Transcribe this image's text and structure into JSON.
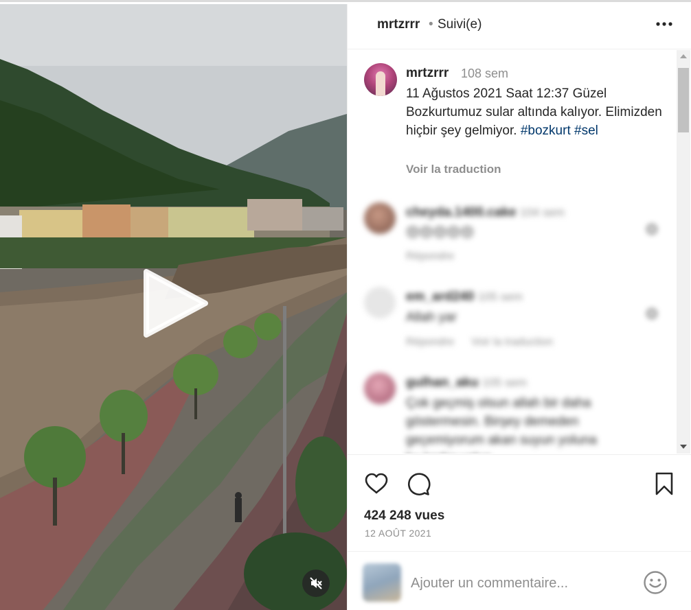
{
  "header": {
    "username": "mrtzrrr",
    "separator": "•",
    "follow_status": "Suivi(e)"
  },
  "caption": {
    "username": "mrtzrrr",
    "time": "108 sem",
    "text": "11 Ağustos 2021 Saat 12:37 Güzel Bozkurtumuz sular altında kalıyor. Elimizden hiçbir şey gelmiyor.",
    "hashtags": [
      "#bozkurt",
      "#sel"
    ],
    "translate_label": "Voir la traduction"
  },
  "comments": [
    {
      "username": "cheyda.1400.cake",
      "time": "104 sem",
      "text": "😔😔😔😔😔",
      "reply_label": "Répondre",
      "translate_label": ""
    },
    {
      "username": "em_ard240",
      "time": "105 sem",
      "text": "Allah yar",
      "reply_label": "Répondre",
      "translate_label": "Voir la traduction"
    },
    {
      "username": "gulhan_aku",
      "time": "105 sem",
      "text": "Çok geçmiş olsun allah bir daha göstermesin. Birşey demeden geçemiyorum akan suyun yoluna bu kadar yakın",
      "reply_label": "",
      "translate_label": ""
    }
  ],
  "stats": {
    "views": "424 248 vues",
    "date": "12 AOÛT 2021"
  },
  "comment_box": {
    "placeholder": "Ajouter un commentaire..."
  },
  "icons": {
    "play": "play-icon",
    "mute": "muted-speaker-icon",
    "more": "more-options-icon",
    "like": "heart-icon",
    "comment": "comment-bubble-icon",
    "save": "bookmark-icon",
    "emoji": "smiley-icon"
  }
}
